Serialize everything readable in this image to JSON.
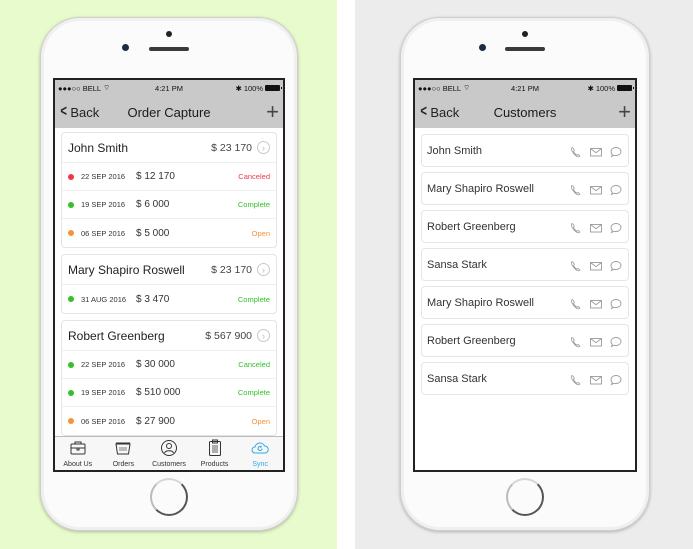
{
  "colors": {
    "left_bg": "#e8fbcc",
    "right_bg": "#ececec",
    "nav_bg": "#c9c9c9",
    "canceled_red": "#f0374a",
    "complete_green": "#33c02a",
    "open_orange": "#f9913a",
    "active_tab": "#2ea8e6"
  },
  "status_bar": {
    "carrier": "●●●○○ BELL",
    "wifi_icon": "wifi-icon",
    "time": "4:21 PM",
    "bluetooth_icon": "bluetooth-icon",
    "battery": "100%"
  },
  "order_screen": {
    "back_label": "Back",
    "title": "Order Capture",
    "add_icon": "+",
    "customers": [
      {
        "name": "John Smith",
        "total": "$ 23 170",
        "orders": [
          {
            "date": "22 SEP 2016",
            "amount": "$ 12 170",
            "status": "Canceled",
            "dot_color": "#f0374a",
            "status_color": "#f0374a"
          },
          {
            "date": "19 SEP 2016",
            "amount": "$ 6 000",
            "status": "Complete",
            "dot_color": "#33c02a",
            "status_color": "#33c02a"
          },
          {
            "date": "06 SEP 2016",
            "amount": "$ 5 000",
            "status": "Open",
            "dot_color": "#f9913a",
            "status_color": "#f9913a"
          }
        ]
      },
      {
        "name": "Mary Shapiro Roswell",
        "total": "$ 23 170",
        "orders": [
          {
            "date": "31 AUG 2016",
            "amount": "$ 3 470",
            "status": "Complete",
            "dot_color": "#33c02a",
            "status_color": "#33c02a"
          }
        ]
      },
      {
        "name": "Robert Greenberg",
        "total": "$ 567 900",
        "orders": [
          {
            "date": "22 SEP 2016",
            "amount": "$ 30 000",
            "status": "Canceled",
            "dot_color": "#33c02a",
            "status_color": "#33c02a"
          },
          {
            "date": "19 SEP 2016",
            "amount": "$ 510 000",
            "status": "Complete",
            "dot_color": "#33c02a",
            "status_color": "#33c02a"
          },
          {
            "date": "06 SEP 2016",
            "amount": "$ 27 900",
            "status": "Open",
            "dot_color": "#f9913a",
            "status_color": "#f9913a"
          }
        ]
      }
    ],
    "tabs": [
      {
        "label": "About Us",
        "icon": "briefcase-icon",
        "active": false
      },
      {
        "label": "Orders",
        "icon": "basket-icon",
        "active": false
      },
      {
        "label": "Customers",
        "icon": "user-icon",
        "active": false
      },
      {
        "label": "Products",
        "icon": "clipboard-icon",
        "active": false
      },
      {
        "label": "Sync",
        "icon": "cloud-sync-icon",
        "active": true
      }
    ]
  },
  "customers_screen": {
    "back_label": "Back",
    "title": "Customers",
    "add_icon": "+",
    "customers": [
      {
        "name": "John Smith"
      },
      {
        "name": "Mary Shapiro Roswell"
      },
      {
        "name": "Robert Greenberg"
      },
      {
        "name": "Sansa Stark"
      },
      {
        "name": "Mary Shapiro Roswell"
      },
      {
        "name": "Robert Greenberg"
      },
      {
        "name": "Sansa Stark"
      }
    ]
  }
}
